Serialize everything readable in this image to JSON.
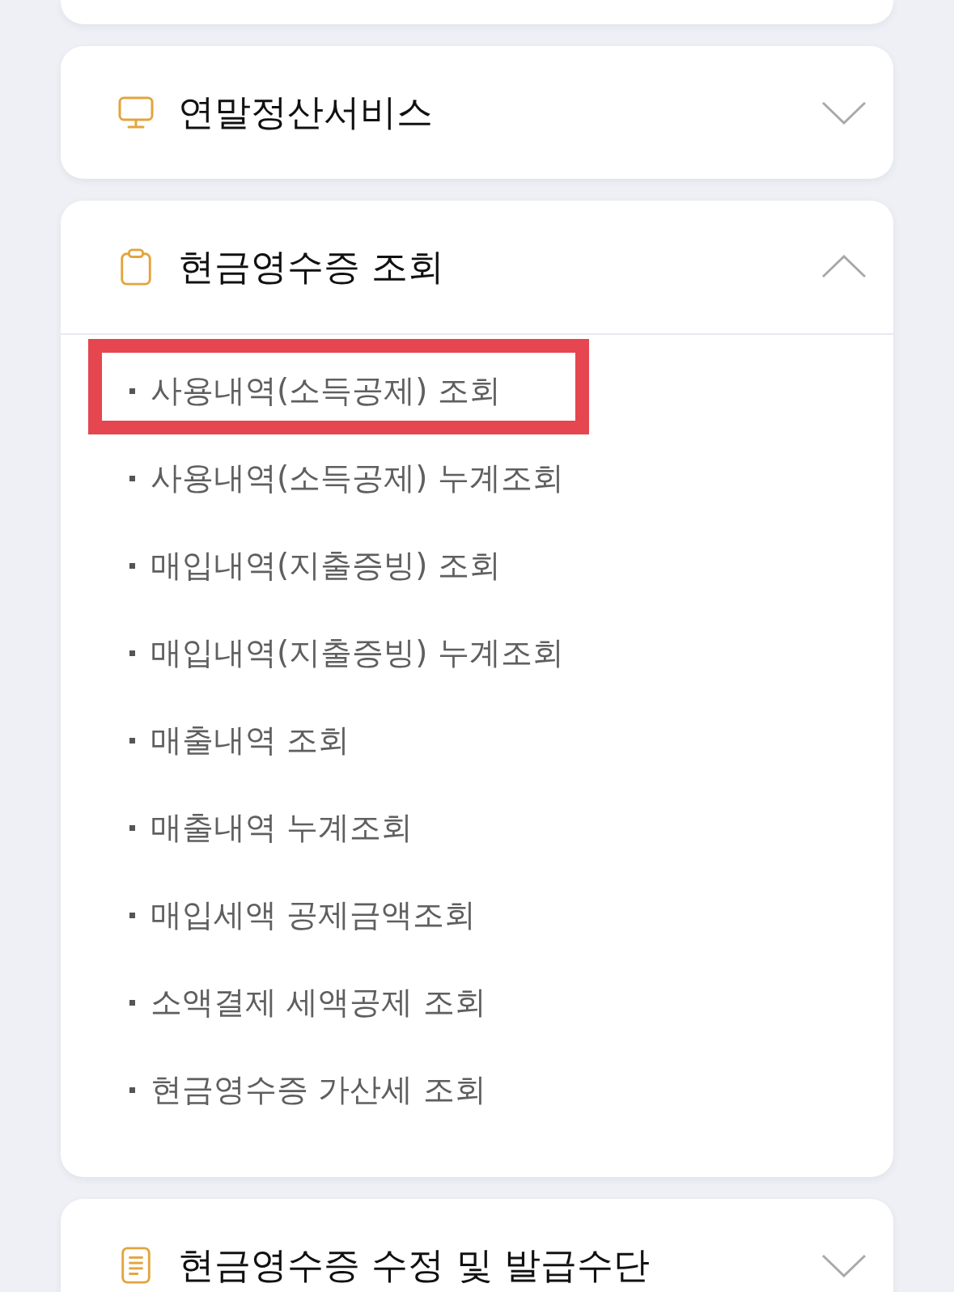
{
  "sections": [
    {
      "title": "연말정산서비스",
      "expanded": false
    },
    {
      "title": "현금영수증 조회",
      "expanded": true,
      "items": [
        {
          "label": "사용내역(소득공제) 조회",
          "highlighted": true
        },
        {
          "label": "사용내역(소득공제) 누계조회",
          "highlighted": false
        },
        {
          "label": "매입내역(지출증빙) 조회",
          "highlighted": false
        },
        {
          "label": "매입내역(지출증빙) 누계조회",
          "highlighted": false
        },
        {
          "label": "매출내역 조회",
          "highlighted": false
        },
        {
          "label": "매출내역 누계조회",
          "highlighted": false
        },
        {
          "label": "매입세액 공제금액조회",
          "highlighted": false
        },
        {
          "label": "소액결제 세액공제 조회",
          "highlighted": false
        },
        {
          "label": "현금영수증 가산세 조회",
          "highlighted": false
        }
      ]
    },
    {
      "title": "현금영수증 수정 및 발급수단",
      "expanded": false
    }
  ]
}
